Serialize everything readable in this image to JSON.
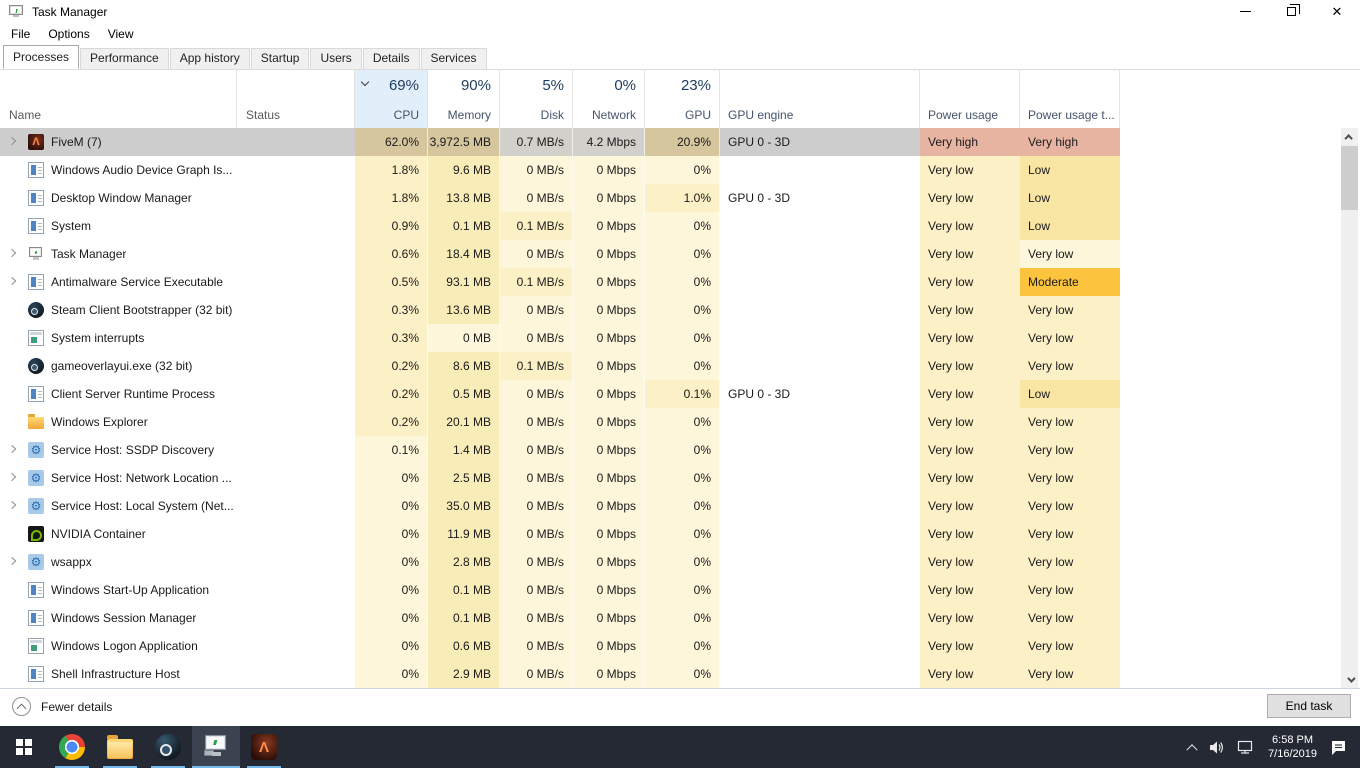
{
  "window": {
    "title": "Task Manager"
  },
  "menu": [
    "File",
    "Options",
    "View"
  ],
  "tabs": [
    {
      "label": "Processes",
      "active": true
    },
    {
      "label": "Performance",
      "active": false
    },
    {
      "label": "App history",
      "active": false
    },
    {
      "label": "Startup",
      "active": false
    },
    {
      "label": "Users",
      "active": false
    },
    {
      "label": "Details",
      "active": false
    },
    {
      "label": "Services",
      "active": false
    }
  ],
  "columns": {
    "name": "Name",
    "status": "Status",
    "cpu": {
      "pct": "69%",
      "label": "CPU",
      "sorted": true
    },
    "memory": {
      "pct": "90%",
      "label": "Memory"
    },
    "disk": {
      "pct": "5%",
      "label": "Disk"
    },
    "network": {
      "pct": "0%",
      "label": "Network"
    },
    "gpu": {
      "pct": "23%",
      "label": "GPU"
    },
    "gpu_engine": "GPU engine",
    "power": "Power usage",
    "power_trend": "Power usage t..."
  },
  "rows": [
    {
      "name": "FiveM (7)",
      "icon": "fivem",
      "expand": true,
      "selected": true,
      "cpu": "62.0%",
      "memory": "3,972.5 MB",
      "disk": "0.7 MB/s",
      "network": "4.2 Mbps",
      "gpu": "20.9%",
      "gpu_engine": "GPU 0 - 3D",
      "power": "Very high",
      "power_trend": "Very high",
      "heat": {
        "cpu": "selt",
        "memory": "selt",
        "disk": "selg",
        "network": "selg",
        "gpu": "selt",
        "power": "vh",
        "power_trend": "vh"
      }
    },
    {
      "name": "Windows Audio Device Graph Is...",
      "icon": "exe",
      "expand": false,
      "selected": false,
      "cpu": "1.8%",
      "memory": "9.6 MB",
      "disk": "0 MB/s",
      "network": "0 Mbps",
      "gpu": "0%",
      "gpu_engine": "",
      "power": "Very low",
      "power_trend": "Low",
      "heat": {
        "cpu": "l",
        "memory": "m",
        "disk": "z",
        "network": "z",
        "gpu": "z",
        "power": "l",
        "power_trend": "h2"
      }
    },
    {
      "name": "Desktop Window Manager",
      "icon": "exe",
      "expand": false,
      "selected": false,
      "cpu": "1.8%",
      "memory": "13.8 MB",
      "disk": "0 MB/s",
      "network": "0 Mbps",
      "gpu": "1.0%",
      "gpu_engine": "GPU 0 - 3D",
      "power": "Very low",
      "power_trend": "Low",
      "heat": {
        "cpu": "l",
        "memory": "m",
        "disk": "z",
        "network": "z",
        "gpu": "l",
        "power": "l",
        "power_trend": "h2"
      }
    },
    {
      "name": "System",
      "icon": "exe",
      "expand": false,
      "selected": false,
      "cpu": "0.9%",
      "memory": "0.1 MB",
      "disk": "0.1 MB/s",
      "network": "0 Mbps",
      "gpu": "0%",
      "gpu_engine": "",
      "power": "Very low",
      "power_trend": "Low",
      "heat": {
        "cpu": "l",
        "memory": "m",
        "disk": "l",
        "network": "z",
        "gpu": "z",
        "power": "l",
        "power_trend": "h2"
      }
    },
    {
      "name": "Task Manager",
      "icon": "taskmgr",
      "expand": true,
      "selected": false,
      "cpu": "0.6%",
      "memory": "18.4 MB",
      "disk": "0 MB/s",
      "network": "0 Mbps",
      "gpu": "0%",
      "gpu_engine": "",
      "power": "Very low",
      "power_trend": "Very low",
      "heat": {
        "cpu": "l",
        "memory": "m",
        "disk": "z",
        "network": "z",
        "gpu": "z",
        "power": "l",
        "power_trend": "z"
      }
    },
    {
      "name": "Antimalware Service Executable",
      "icon": "exe",
      "expand": true,
      "selected": false,
      "cpu": "0.5%",
      "memory": "93.1 MB",
      "disk": "0.1 MB/s",
      "network": "0 Mbps",
      "gpu": "0%",
      "gpu_engine": "",
      "power": "Very low",
      "power_trend": "Moderate",
      "heat": {
        "cpu": "l",
        "memory": "m",
        "disk": "l",
        "network": "z",
        "gpu": "z",
        "power": "l",
        "power_trend": "h3"
      }
    },
    {
      "name": "Steam Client Bootstrapper (32 bit)",
      "icon": "steam",
      "expand": false,
      "selected": false,
      "cpu": "0.3%",
      "memory": "13.6 MB",
      "disk": "0 MB/s",
      "network": "0 Mbps",
      "gpu": "0%",
      "gpu_engine": "",
      "power": "Very low",
      "power_trend": "Very low",
      "heat": {
        "cpu": "l",
        "memory": "m",
        "disk": "z",
        "network": "z",
        "gpu": "z",
        "power": "l",
        "power_trend": "l"
      }
    },
    {
      "name": "System interrupts",
      "icon": "console",
      "expand": false,
      "selected": false,
      "cpu": "0.3%",
      "memory": "0 MB",
      "disk": "0 MB/s",
      "network": "0 Mbps",
      "gpu": "0%",
      "gpu_engine": "",
      "power": "Very low",
      "power_trend": "Very low",
      "heat": {
        "cpu": "l",
        "memory": "z",
        "disk": "z",
        "network": "z",
        "gpu": "z",
        "power": "l",
        "power_trend": "l"
      }
    },
    {
      "name": "gameoverlayui.exe (32 bit)",
      "icon": "steam",
      "expand": false,
      "selected": false,
      "cpu": "0.2%",
      "memory": "8.6 MB",
      "disk": "0.1 MB/s",
      "network": "0 Mbps",
      "gpu": "0%",
      "gpu_engine": "",
      "power": "Very low",
      "power_trend": "Very low",
      "heat": {
        "cpu": "l",
        "memory": "m",
        "disk": "l",
        "network": "z",
        "gpu": "z",
        "power": "l",
        "power_trend": "l"
      }
    },
    {
      "name": "Client Server Runtime Process",
      "icon": "exe",
      "expand": false,
      "selected": false,
      "cpu": "0.2%",
      "memory": "0.5 MB",
      "disk": "0 MB/s",
      "network": "0 Mbps",
      "gpu": "0.1%",
      "gpu_engine": "GPU 0 - 3D",
      "power": "Very low",
      "power_trend": "Low",
      "heat": {
        "cpu": "l",
        "memory": "m",
        "disk": "z",
        "network": "z",
        "gpu": "l",
        "power": "l",
        "power_trend": "h2"
      }
    },
    {
      "name": "Windows Explorer",
      "icon": "folder",
      "expand": false,
      "selected": false,
      "cpu": "0.2%",
      "memory": "20.1 MB",
      "disk": "0 MB/s",
      "network": "0 Mbps",
      "gpu": "0%",
      "gpu_engine": "",
      "power": "Very low",
      "power_trend": "Very low",
      "heat": {
        "cpu": "l",
        "memory": "m",
        "disk": "z",
        "network": "z",
        "gpu": "z",
        "power": "l",
        "power_trend": "l"
      }
    },
    {
      "name": "Service Host: SSDP Discovery",
      "icon": "gear",
      "expand": true,
      "selected": false,
      "cpu": "0.1%",
      "memory": "1.4 MB",
      "disk": "0 MB/s",
      "network": "0 Mbps",
      "gpu": "0%",
      "gpu_engine": "",
      "power": "Very low",
      "power_trend": "Very low",
      "heat": {
        "cpu": "z",
        "memory": "m",
        "disk": "z",
        "network": "z",
        "gpu": "z",
        "power": "l",
        "power_trend": "l"
      }
    },
    {
      "name": "Service Host: Network Location ...",
      "icon": "gear",
      "expand": true,
      "selected": false,
      "cpu": "0%",
      "memory": "2.5 MB",
      "disk": "0 MB/s",
      "network": "0 Mbps",
      "gpu": "0%",
      "gpu_engine": "",
      "power": "Very low",
      "power_trend": "Very low",
      "heat": {
        "cpu": "z",
        "memory": "m",
        "disk": "z",
        "network": "z",
        "gpu": "z",
        "power": "l",
        "power_trend": "l"
      }
    },
    {
      "name": "Service Host: Local System (Net...",
      "icon": "gear",
      "expand": true,
      "selected": false,
      "cpu": "0%",
      "memory": "35.0 MB",
      "disk": "0 MB/s",
      "network": "0 Mbps",
      "gpu": "0%",
      "gpu_engine": "",
      "power": "Very low",
      "power_trend": "Very low",
      "heat": {
        "cpu": "z",
        "memory": "m",
        "disk": "z",
        "network": "z",
        "gpu": "z",
        "power": "l",
        "power_trend": "l"
      }
    },
    {
      "name": "NVIDIA Container",
      "icon": "nvidia",
      "expand": false,
      "selected": false,
      "cpu": "0%",
      "memory": "11.9 MB",
      "disk": "0 MB/s",
      "network": "0 Mbps",
      "gpu": "0%",
      "gpu_engine": "",
      "power": "Very low",
      "power_trend": "Very low",
      "heat": {
        "cpu": "z",
        "memory": "m",
        "disk": "z",
        "network": "z",
        "gpu": "z",
        "power": "l",
        "power_trend": "l"
      }
    },
    {
      "name": "wsappx",
      "icon": "gear",
      "expand": true,
      "selected": false,
      "cpu": "0%",
      "memory": "2.8 MB",
      "disk": "0 MB/s",
      "network": "0 Mbps",
      "gpu": "0%",
      "gpu_engine": "",
      "power": "Very low",
      "power_trend": "Very low",
      "heat": {
        "cpu": "z",
        "memory": "m",
        "disk": "z",
        "network": "z",
        "gpu": "z",
        "power": "l",
        "power_trend": "l"
      }
    },
    {
      "name": "Windows Start-Up Application",
      "icon": "exe",
      "expand": false,
      "selected": false,
      "cpu": "0%",
      "memory": "0.1 MB",
      "disk": "0 MB/s",
      "network": "0 Mbps",
      "gpu": "0%",
      "gpu_engine": "",
      "power": "Very low",
      "power_trend": "Very low",
      "heat": {
        "cpu": "z",
        "memory": "m",
        "disk": "z",
        "network": "z",
        "gpu": "z",
        "power": "l",
        "power_trend": "l"
      }
    },
    {
      "name": "Windows Session Manager",
      "icon": "exe",
      "expand": false,
      "selected": false,
      "cpu": "0%",
      "memory": "0.1 MB",
      "disk": "0 MB/s",
      "network": "0 Mbps",
      "gpu": "0%",
      "gpu_engine": "",
      "power": "Very low",
      "power_trend": "Very low",
      "heat": {
        "cpu": "z",
        "memory": "m",
        "disk": "z",
        "network": "z",
        "gpu": "z",
        "power": "l",
        "power_trend": "l"
      }
    },
    {
      "name": "Windows Logon Application",
      "icon": "console",
      "expand": false,
      "selected": false,
      "cpu": "0%",
      "memory": "0.6 MB",
      "disk": "0 MB/s",
      "network": "0 Mbps",
      "gpu": "0%",
      "gpu_engine": "",
      "power": "Very low",
      "power_trend": "Very low",
      "heat": {
        "cpu": "z",
        "memory": "m",
        "disk": "z",
        "network": "z",
        "gpu": "z",
        "power": "l",
        "power_trend": "l"
      }
    },
    {
      "name": "Shell Infrastructure Host",
      "icon": "exe",
      "expand": false,
      "selected": false,
      "cpu": "0%",
      "memory": "2.9 MB",
      "disk": "0 MB/s",
      "network": "0 Mbps",
      "gpu": "0%",
      "gpu_engine": "",
      "power": "Very low",
      "power_trend": "Very low",
      "heat": {
        "cpu": "z",
        "memory": "m",
        "disk": "z",
        "network": "z",
        "gpu": "z",
        "power": "l",
        "power_trend": "l"
      }
    }
  ],
  "footer": {
    "fewer_details": "Fewer details",
    "end_task": "End task"
  },
  "taskbar": {
    "apps": [
      {
        "id": "chrome",
        "running": true,
        "active": false
      },
      {
        "id": "explorer",
        "running": true,
        "active": false
      },
      {
        "id": "steam",
        "running": true,
        "active": false
      },
      {
        "id": "taskmgr",
        "running": true,
        "active": true
      },
      {
        "id": "fivem",
        "running": true,
        "active": false
      }
    ],
    "clock_time": "6:58 PM",
    "clock_date": "7/16/2019"
  },
  "icons": {
    "window": [
      "minimize-icon",
      "restore-icon",
      "close-icon"
    ],
    "sort_indicator": "chevron-down",
    "fewer_details": "circled-chevron-up",
    "tray": [
      "hidden-icons-chevron",
      "volume-icon",
      "network-icon",
      "action-center-icon"
    ],
    "process_icon_glyphs": {
      "fivem": "Λ",
      "gear": "⚙"
    }
  },
  "colors": {
    "selection_gray": "#cdcdcd",
    "heat_zero": "#fdf6da",
    "heat_low": "#fcf1c6",
    "heat_mem": "#f8ecb8",
    "heat_low_mid": "#f9e6a4",
    "heat_moderate": "#fcc43e",
    "heat_very_high": "#e7b4a2",
    "sorted_column_bg": "#e2eefa",
    "taskbar_bg": "#242933",
    "running_underline": "#76b9ed"
  }
}
